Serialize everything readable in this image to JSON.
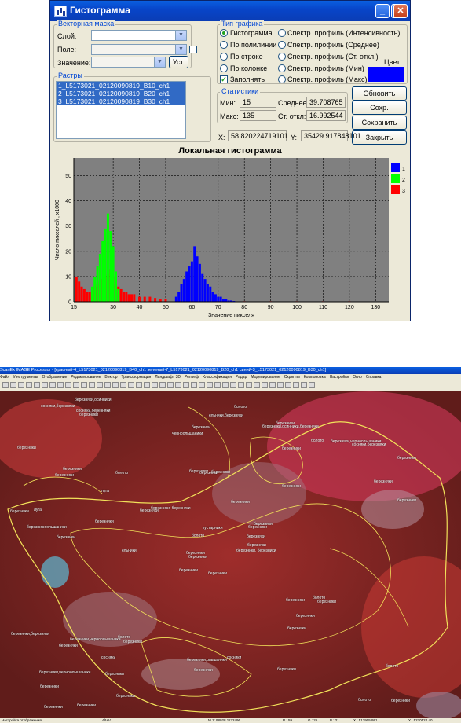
{
  "window": {
    "title": "Гистограмма"
  },
  "vector_mask": {
    "title": "Векторная маска",
    "layer_label": "Слой:",
    "field_label": "Поле:",
    "value_label": "Значение:",
    "set_button": "Уст."
  },
  "rasters": {
    "title": "Растры",
    "items": [
      "1_L5173021_02120090819_B10_ch1",
      "2_L5173021_02120090819_B20_ch1",
      "3_L5173021_02120090819_B30_ch1"
    ]
  },
  "chart_type": {
    "title": "Тип графика",
    "options_left": [
      "Гистограмма",
      "По полилинии",
      "По строке",
      "По колонке"
    ],
    "options_right": [
      "Спектр. профиль (Интенсивность)",
      "Спектр. профиль (Среднее)",
      "Спектр. профиль (Ст. откл.)",
      "Спектр. профиль (Мин)",
      "Спектр. профиль (Макс)"
    ],
    "selected": "Гистограмма",
    "fill_label": "Заполнять",
    "fill_checked": true,
    "color_label": "Цвет:",
    "color_value": "#0000ff"
  },
  "stats": {
    "title": "Статистики",
    "min_label": "Мин:",
    "min_value": "15",
    "max_label": "Макс:",
    "max_value": "135",
    "mean_label": "Среднее:",
    "mean_value": "39.708765",
    "std_label": "Ст. откл:",
    "std_value": "16.992544"
  },
  "buttons": {
    "refresh": "Обновить",
    "save_meta": "Сохр. метафайл",
    "save_report": "Сохранить отчет",
    "close": "Закрыть"
  },
  "coords": {
    "x_label": "X:",
    "x_value": "58.820224719101",
    "y_label": "Y:",
    "y_value": "35429.917848101"
  },
  "chart_data": {
    "type": "bar",
    "title": "Локальная гистограмма",
    "xlabel": "Значение пикселя",
    "ylabel": "Число пикселей , x1000",
    "xlim": [
      15,
      135
    ],
    "ylim": [
      0,
      57
    ],
    "xticks": [
      15,
      30,
      40,
      50,
      60,
      70,
      80,
      90,
      100,
      110,
      120,
      130
    ],
    "yticks": [
      0,
      10,
      20,
      30,
      40,
      50
    ],
    "plot_background": "#808080",
    "grid": true,
    "legend_position": "right",
    "series": [
      {
        "name": "1",
        "color": "#0000ff",
        "x": [
          54,
          55,
          56,
          57,
          58,
          59,
          60,
          61,
          62,
          63,
          64,
          65,
          66,
          67,
          68,
          69,
          70,
          71,
          72,
          73,
          74,
          75,
          76
        ],
        "values": [
          2,
          4,
          7,
          9,
          12,
          14,
          16,
          22,
          18,
          15,
          11,
          9,
          7,
          6,
          4,
          3,
          2,
          2,
          1,
          1,
          0.5,
          0.5,
          0.3
        ]
      },
      {
        "name": "2",
        "color": "#00ff00",
        "x": [
          22,
          23,
          24,
          25,
          26,
          27,
          28,
          29,
          30,
          31,
          32
        ],
        "values": [
          6,
          10,
          14,
          19,
          24,
          29,
          35,
          28,
          22,
          12,
          5
        ]
      },
      {
        "name": "3",
        "color": "#ff0000",
        "x": [
          16,
          17,
          18,
          19,
          20,
          21,
          22,
          23,
          24,
          25,
          26,
          27,
          28,
          29,
          30,
          31,
          32,
          33,
          34,
          35,
          36,
          37,
          38,
          40,
          42,
          44,
          46,
          48,
          50,
          55,
          60,
          70,
          80,
          90,
          100,
          110,
          120,
          130
        ],
        "values": [
          10,
          8,
          6,
          5,
          4,
          4,
          5,
          6,
          7,
          8,
          9,
          10,
          11,
          13,
          10,
          7,
          6,
          5,
          4,
          4,
          3,
          3,
          3,
          2,
          2,
          2,
          1.5,
          1,
          1,
          0.6,
          0.5,
          0.3,
          0.2,
          0.2,
          0.2,
          0.2,
          0.2,
          0.1
        ]
      }
    ]
  },
  "app": {
    "title": "ScanEx IMAGE Processor - [красный-4_L5173021_02120090819_B40_ch1 зеленый-7_L5173021_02120090819_B20_ch1 синий-3_L5173021_02120090819_B30_ch1]",
    "menu": [
      "Файл",
      "Инструменты",
      "Отображение",
      "Редактирование",
      "Вектор",
      "Трансформация",
      "Ландшафт 3D",
      "Рельеф",
      "Классификация",
      "Радар",
      "Моделирование",
      "Скрипты",
      "Компоновка",
      "Настройки",
      "Окно",
      "Справка"
    ],
    "map_labels": [
      "березники",
      "березники",
      "березники",
      "березники,черноолышаники",
      "березники",
      "березники",
      "березники",
      "березники",
      "березники",
      "березники, березники",
      "березники",
      "березники",
      "березники",
      "березники",
      "березники",
      "березники",
      "березники",
      "березники",
      "березники",
      "березники,черноольшаники",
      "березники, березники",
      "березники",
      "березники",
      "березники",
      "березники",
      "березники",
      "березники",
      "березники",
      "березники,ольшаники",
      "березники",
      "березники",
      "березники",
      "березники,ольшаники",
      "болото",
      "болото",
      "болото",
      "болото",
      "болото",
      "болото",
      "болото",
      "болото",
      "березняки",
      "березняки",
      "березняки",
      "березняки",
      "березняки",
      "березняки",
      "березняки",
      "березняки",
      "березняки",
      "березняки",
      "березняки",
      "березняки",
      "березняки",
      "березняки",
      "сосняки",
      "сосняки,березняки",
      "сосняки,березняки",
      "сосняки",
      "сосняки,березняки",
      "ельники,березняки",
      "ельники",
      "луга",
      "луга",
      "березняки,черноольшаники",
      "березняки,осинники",
      "березняки,осинники,березняки",
      "черноольшаники",
      "кустарники",
      "березняки,березняки"
    ],
    "status": {
      "hint": "Настройка отображения",
      "mode": "Alt+V",
      "m": "M 1:  98028.1132496",
      "r": "R :  59",
      "g": "G :  26",
      "b": "B :  21",
      "x": "X :  517905.991",
      "y": "Y :  5270524.40"
    }
  }
}
